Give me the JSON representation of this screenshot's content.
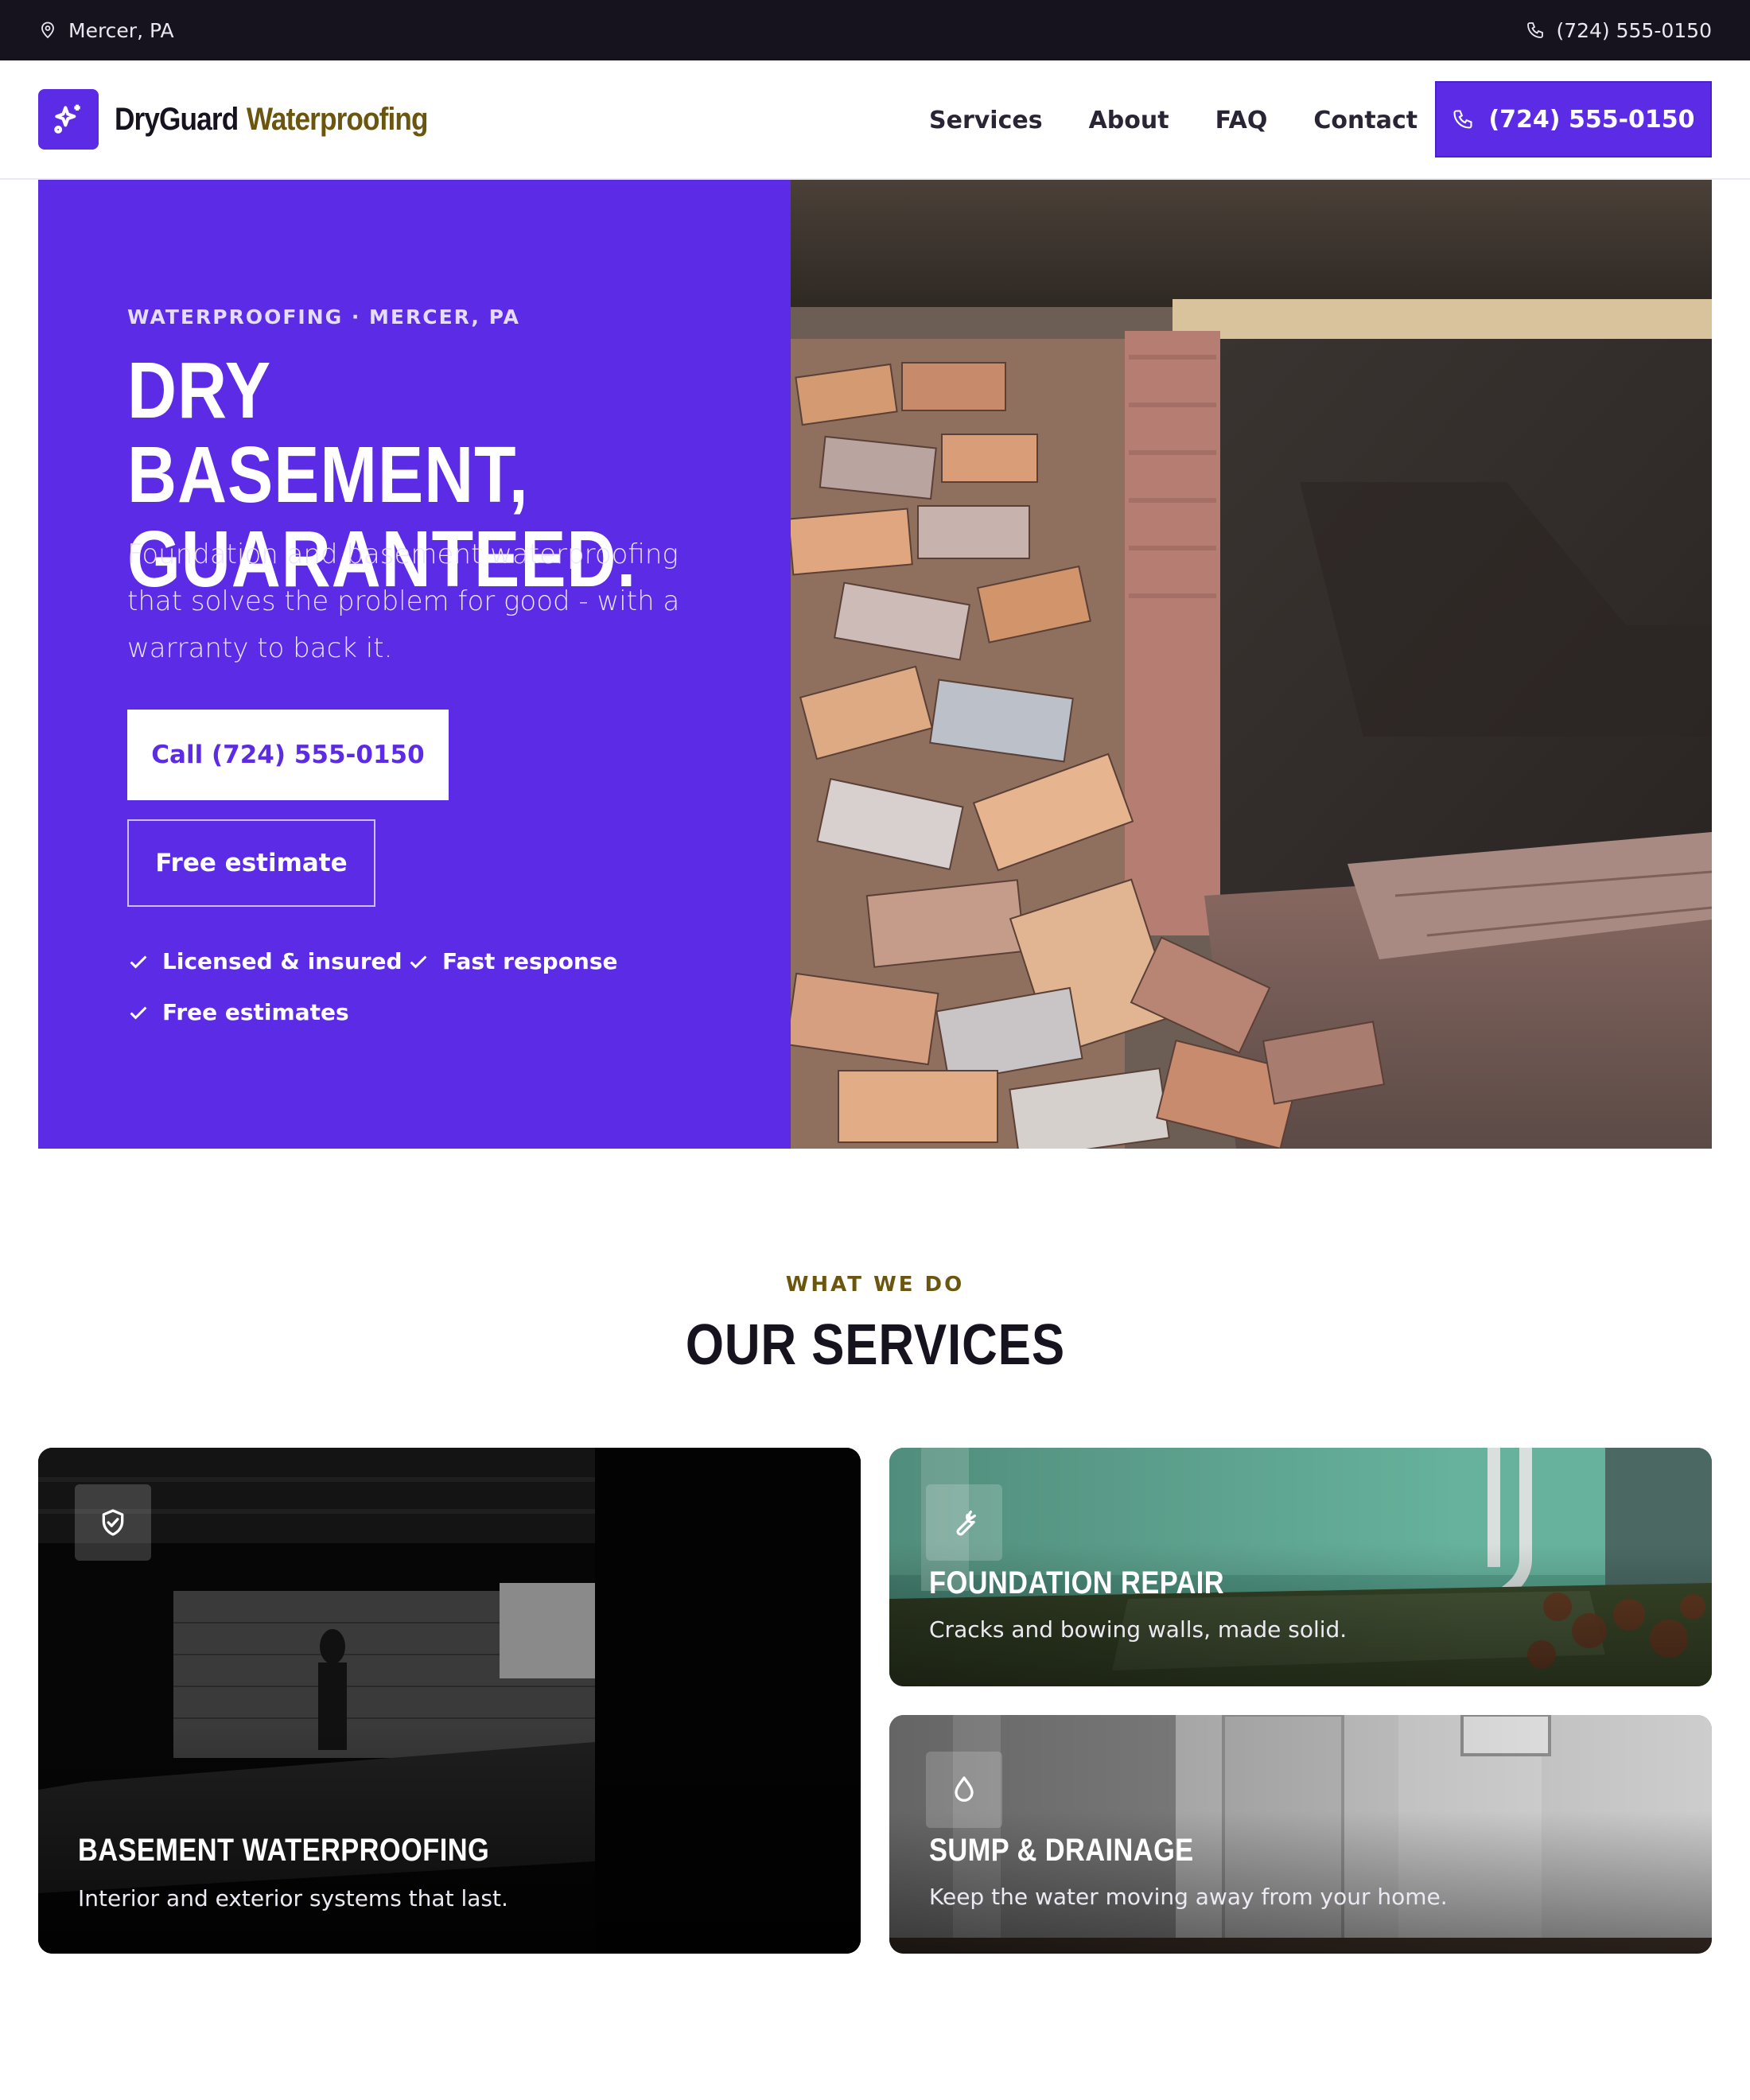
{
  "topbar": {
    "location": "Mercer, PA",
    "phone": "(724) 555-0150"
  },
  "nav": {
    "brand_primary": "DryGuard",
    "brand_secondary": "Waterproofing",
    "links": [
      "Services",
      "About",
      "FAQ",
      "Contact"
    ],
    "cta_phone": "(724) 555-0150"
  },
  "hero": {
    "eyebrow": "WATERPROOFING · MERCER, PA",
    "headline_line1": "DRY BASEMENT,",
    "headline_line2": "GUARANTEED.",
    "subtext": "Foundation and basement waterproofing that solves the problem for good - with a warranty to back it.",
    "call_button": "Call (724) 555-0150",
    "estimate_button": "Free estimate",
    "badges": [
      "Licensed & insured",
      "Fast response",
      "Free estimates"
    ]
  },
  "services": {
    "eyebrow": "WHAT WE DO",
    "title": "OUR SERVICES",
    "cards": [
      {
        "title": "BASEMENT WATERPROOFING",
        "description": "Interior and exterior systems that last.",
        "icon": "shield-check-icon"
      },
      {
        "title": "FOUNDATION REPAIR",
        "description": "Cracks and bowing walls, made solid.",
        "icon": "wrench-icon"
      },
      {
        "title": "SUMP & DRAINAGE",
        "description": "Keep the water moving away from your home.",
        "icon": "water-drop-icon"
      }
    ]
  },
  "colors": {
    "brand_purple": "#5b2be5",
    "brand_gold": "#6b5610",
    "dark": "#16131f"
  }
}
